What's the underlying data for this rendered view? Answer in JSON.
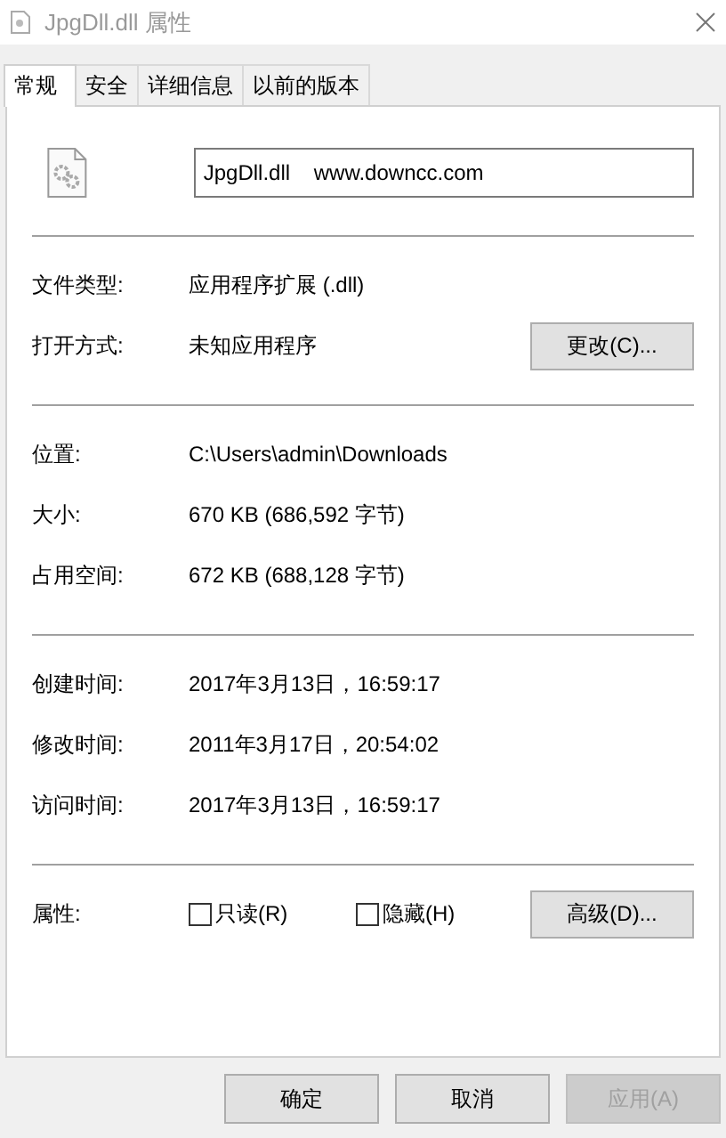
{
  "window": {
    "title": "JpgDll.dll 属性"
  },
  "tabs": [
    {
      "label": "常规",
      "selected": true
    },
    {
      "label": "安全",
      "selected": false
    },
    {
      "label": "详细信息",
      "selected": false
    },
    {
      "label": "以前的版本",
      "selected": false
    }
  ],
  "name_field": {
    "value": "JpgDll.dll    www.downcc.com"
  },
  "sections": [
    [
      {
        "label": "文件类型:",
        "value": "应用程序扩展 (.dll)"
      },
      {
        "label": "打开方式:",
        "value": "未知应用程序",
        "button": "更改(C)..."
      }
    ],
    [
      {
        "label": "位置:",
        "value": "C:\\Users\\admin\\Downloads"
      },
      {
        "label": "大小:",
        "value": "670 KB (686,592 字节)"
      },
      {
        "label": "占用空间:",
        "value": "672 KB (688,128 字节)"
      }
    ],
    [
      {
        "label": "创建时间:",
        "value": "2017年3月13日，16:59:17"
      },
      {
        "label": "修改时间:",
        "value": "2011年3月17日，20:54:02"
      },
      {
        "label": "访问时间:",
        "value": "2017年3月13日，16:59:17"
      }
    ]
  ],
  "attributes": {
    "label": "属性:",
    "checkboxes": [
      {
        "label": "只读(R)",
        "checked": false
      },
      {
        "label": "隐藏(H)",
        "checked": false
      }
    ],
    "button": "高级(D)..."
  },
  "buttons": [
    {
      "label": "确定",
      "disabled": false
    },
    {
      "label": "取消",
      "disabled": false
    },
    {
      "label": "应用(A)",
      "disabled": true
    }
  ]
}
